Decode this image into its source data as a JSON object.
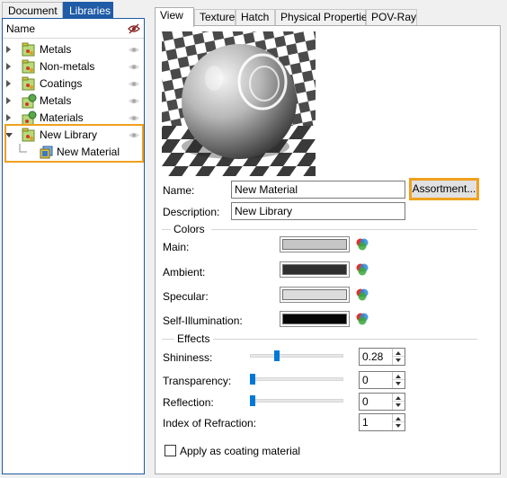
{
  "left_tabs": [
    "Document",
    "Libraries"
  ],
  "tree": {
    "header": "Name",
    "header_icon": "visibility-toggle-icon",
    "items": [
      {
        "label": "Metals",
        "icon": "library-icon",
        "expanded": false,
        "visible": true
      },
      {
        "label": "Non-metals",
        "icon": "library-icon",
        "expanded": false,
        "visible": true
      },
      {
        "label": "Coatings",
        "icon": "library-icon",
        "expanded": false,
        "visible": true
      },
      {
        "label": "Metals",
        "icon": "library-globe-icon",
        "expanded": false,
        "visible": true
      },
      {
        "label": "Materials",
        "icon": "library-globe-icon",
        "expanded": false,
        "visible": true
      },
      {
        "label": "New Library",
        "icon": "library-icon",
        "expanded": true,
        "visible": true
      },
      {
        "label": "New Material",
        "icon": "material-icon",
        "child": true
      }
    ]
  },
  "right_tabs": [
    "View",
    "Texture",
    "Hatch",
    "Physical Properties",
    "POV-Ray"
  ],
  "form": {
    "name_label": "Name:",
    "name_value": "New Material",
    "assortment_button": "Assortment...",
    "description_label": "Description:",
    "description_value": "New Library",
    "colors_title": "Colors",
    "main_label": "Main:",
    "ambient_label": "Ambient:",
    "specular_label": "Specular:",
    "self_illum_label": "Self-Illumination:",
    "effects_title": "Effects",
    "shininess_label": "Shininess:",
    "shininess_value": "0.28",
    "transparency_label": "Transparency:",
    "transparency_value": "0",
    "reflection_label": "Reflection:",
    "reflection_value": "0",
    "ior_label": "Index of Refraction:",
    "ior_value": "1",
    "coating_label": "Apply as coating material"
  },
  "colors": {
    "main": "#c6c6c6",
    "ambient": "#2f2f2f",
    "specular": "#dcdcdc",
    "self_illumination": "#050505",
    "accent": "#1f5ba6",
    "highlight": "#f0a01e"
  },
  "sliders": {
    "shininess": 0.28,
    "transparency": 0,
    "reflection": 0
  }
}
